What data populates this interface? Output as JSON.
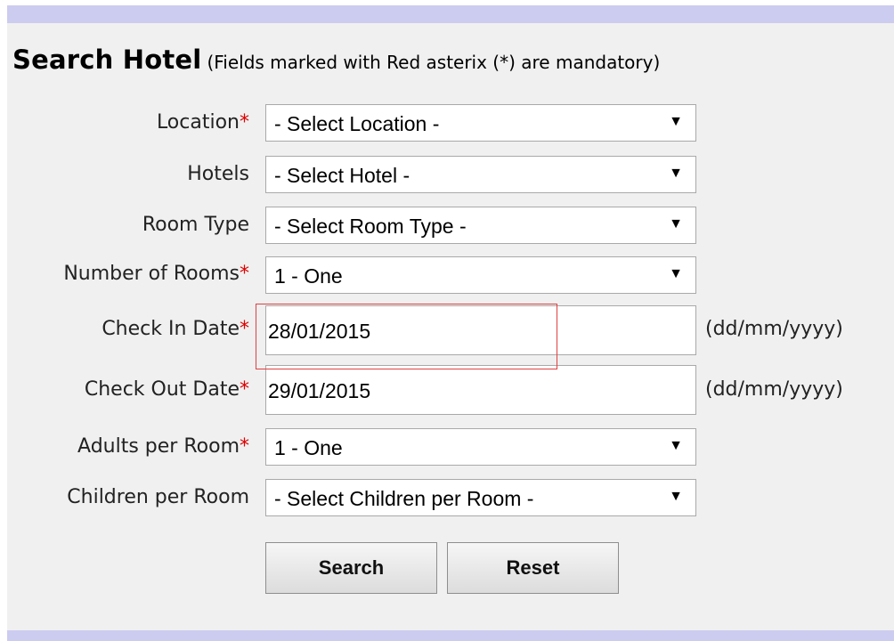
{
  "form": {
    "title": "Search Hotel",
    "note": "(Fields marked with Red asterix (*) are mandatory)",
    "required_marker": "*",
    "location": {
      "label": "Location",
      "value": "- Select Location -"
    },
    "hotels": {
      "label": "Hotels",
      "value": "- Select Hotel -"
    },
    "room_type": {
      "label": "Room Type",
      "value": "- Select Room Type -"
    },
    "rooms": {
      "label": "Number of Rooms",
      "value": "1 - One"
    },
    "check_in": {
      "label": "Check In Date",
      "value": "28/01/2015",
      "hint": "(dd/mm/yyyy)"
    },
    "check_out": {
      "label": "Check Out Date",
      "value": "29/01/2015",
      "hint": "(dd/mm/yyyy)"
    },
    "adults": {
      "label": "Adults per Room",
      "value": "1 - One"
    },
    "children": {
      "label": "Children per Room",
      "value": "- Select Children per Room -"
    },
    "search_label": "Search",
    "reset_label": "Reset"
  },
  "icons": {
    "dropdown_arrow": "chevron-down-icon"
  },
  "colors": {
    "page_background": "#f0f0f0",
    "header_band": "#ccccf0",
    "required_asterisk": "#dd0000",
    "highlight_border": "#e04040"
  }
}
